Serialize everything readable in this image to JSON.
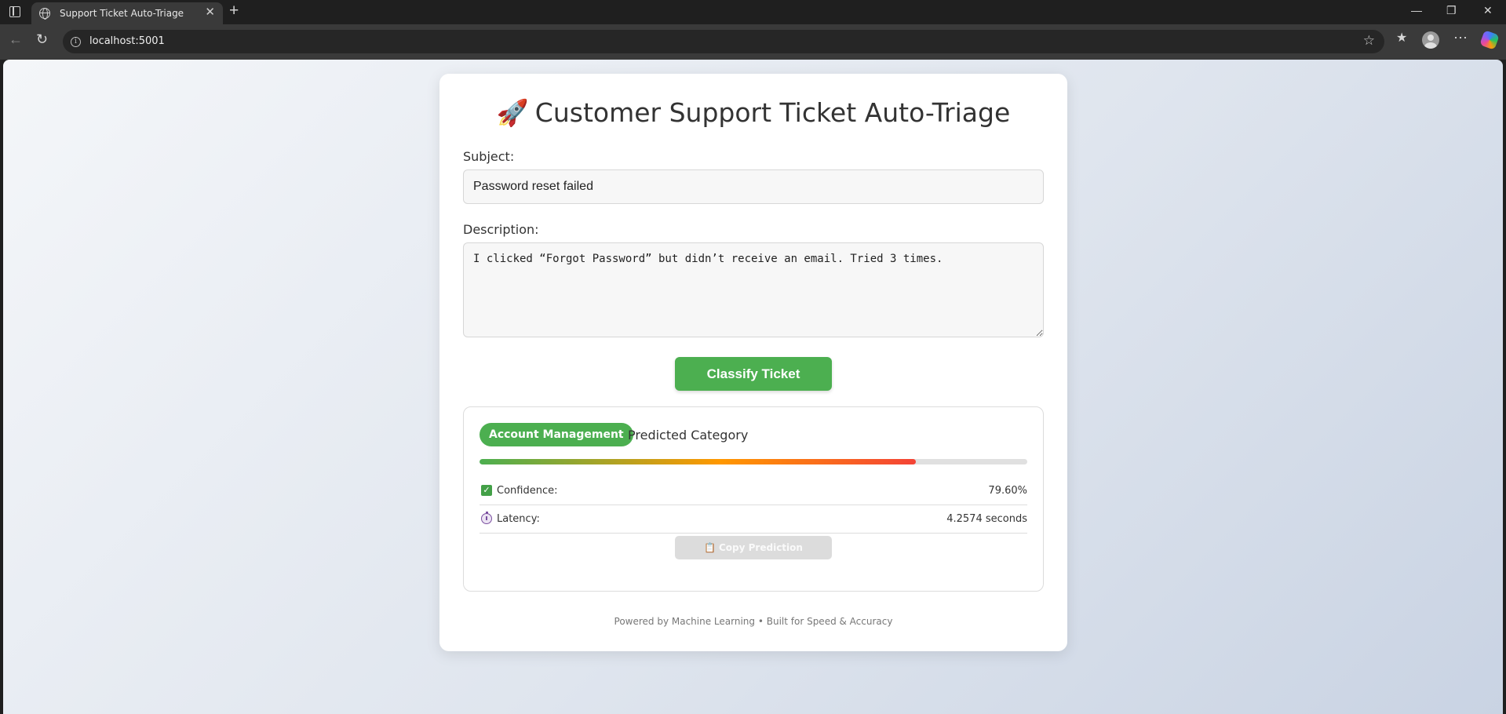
{
  "browser": {
    "tab_title": "Support Ticket Auto-Triage",
    "tab_close": "✕",
    "new_tab": "+",
    "url": "localhost:5001",
    "window_controls": [
      "—",
      "❐",
      "✕"
    ]
  },
  "app": {
    "title_icon": "🚀",
    "title": "Customer Support Ticket Auto-Triage",
    "subject_label": "Subject:",
    "subject_value": "Password reset failed",
    "description_label": "Description:",
    "description_value": "I clicked “Forgot Password” but didn’t receive an email. Tried 3 times.",
    "classify_button": "Classify Ticket"
  },
  "result": {
    "category": "Account Management",
    "category_caption": "Predicted Category",
    "confidence_fraction": 0.796,
    "confidence_label": "Confidence:",
    "confidence_value": "79.60%",
    "latency_label": "Latency:",
    "latency_value": "4.2574 seconds",
    "copy_button_icon": "📋",
    "copy_button": "Copy Prediction"
  },
  "footer": "Powered by Machine Learning • Built for Speed & Accuracy",
  "icons": {
    "confidence": "check-square-icon",
    "latency": "stopwatch-icon",
    "copy": "clipboard-icon"
  },
  "colors": {
    "accent_green": "#4caf50",
    "bar_mid": "#ff9800",
    "bar_end": "#f44336"
  }
}
